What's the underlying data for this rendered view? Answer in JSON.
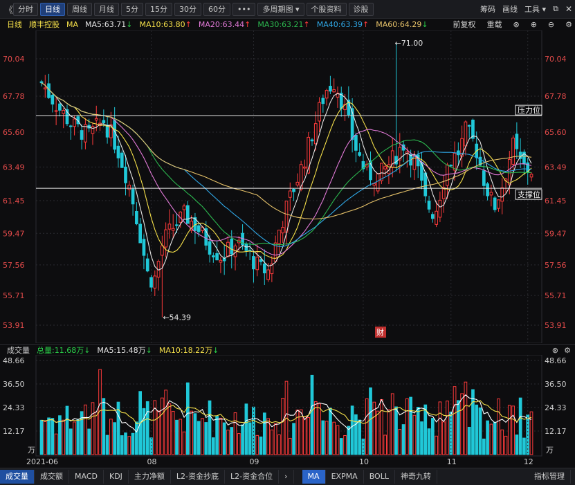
{
  "toolbar": {
    "back": "《",
    "periods": [
      "分时",
      "日线",
      "周线",
      "月线",
      "5分",
      "15分",
      "30分",
      "60分",
      "•••"
    ],
    "active_period": "日线",
    "multi": "多周期图 ▾",
    "stock_info": "个股资料",
    "diagnose": "诊股",
    "right_items": [
      "筹码",
      "画线",
      "工具 ▾"
    ]
  },
  "ma_line": {
    "period": "日线",
    "name": "顺丰控股",
    "label": "MA",
    "items": [
      {
        "text": "MA5:63.71",
        "arrow": "↓",
        "color": "#e6e6e6"
      },
      {
        "text": "MA10:63.80",
        "arrow": "↑",
        "color": "#f5e04a"
      },
      {
        "text": "MA20:63.44",
        "arrow": "↑",
        "color": "#e27ad8"
      },
      {
        "text": "MA30:63.21",
        "arrow": "↑",
        "color": "#2cb84f"
      },
      {
        "text": "MA40:63.39",
        "arrow": "↑",
        "color": "#2fa7e6"
      },
      {
        "text": "MA60:64.29",
        "arrow": "↓",
        "color": "#e7c36a"
      }
    ],
    "right": [
      "前复权",
      "重载"
    ]
  },
  "chart_data": [
    {
      "type": "candlestick",
      "title": "",
      "yticks": [
        70.04,
        67.78,
        65.6,
        63.49,
        61.45,
        59.47,
        57.56,
        55.71,
        53.91
      ],
      "ylim": [
        53.91,
        70.04
      ],
      "annotations": [
        {
          "text": "←71.00",
          "value": 71.0
        },
        {
          "text": "←54.39",
          "value": 54.39
        },
        {
          "text": "财",
          "month": "10"
        }
      ],
      "horizontal_lines": [
        {
          "label": "压力位",
          "value": 66.6
        },
        {
          "label": "支撑位",
          "value": 62.2
        }
      ],
      "x_months": [
        "2021-06",
        "08",
        "09",
        "10",
        "11",
        "12"
      ],
      "series_names": [
        "MA5",
        "MA10",
        "MA20",
        "MA30",
        "MA40",
        "MA60"
      ]
    },
    {
      "type": "bar",
      "title": "成交量",
      "header": {
        "total": "总量:11.68万",
        "total_arrow": "↓",
        "ma5": "MA5:15.48万",
        "ma5_arrow": "↓",
        "ma10": "MA10:18.22万",
        "ma10_arrow": "↓"
      },
      "yticks": [
        48.66,
        36.5,
        24.33,
        12.17
      ],
      "unit": "万",
      "ylim": [
        0,
        48.66
      ]
    }
  ],
  "tabs": [
    "成交量",
    "成交额",
    "MACD",
    "KDJ",
    "主力净额",
    "L2-资金抄底",
    "L2-资金合位"
  ],
  "tabs_right": [
    "MA",
    "EXPMA",
    "BOLL",
    "神奇九转"
  ],
  "active_tab": "成交量",
  "selected_right": "MA",
  "indicator_btn": "指标管理",
  "more_arrow": "›",
  "colors": {
    "up": "#ff3b3b",
    "down": "#20c8d8",
    "bg": "#0d0d0f"
  }
}
